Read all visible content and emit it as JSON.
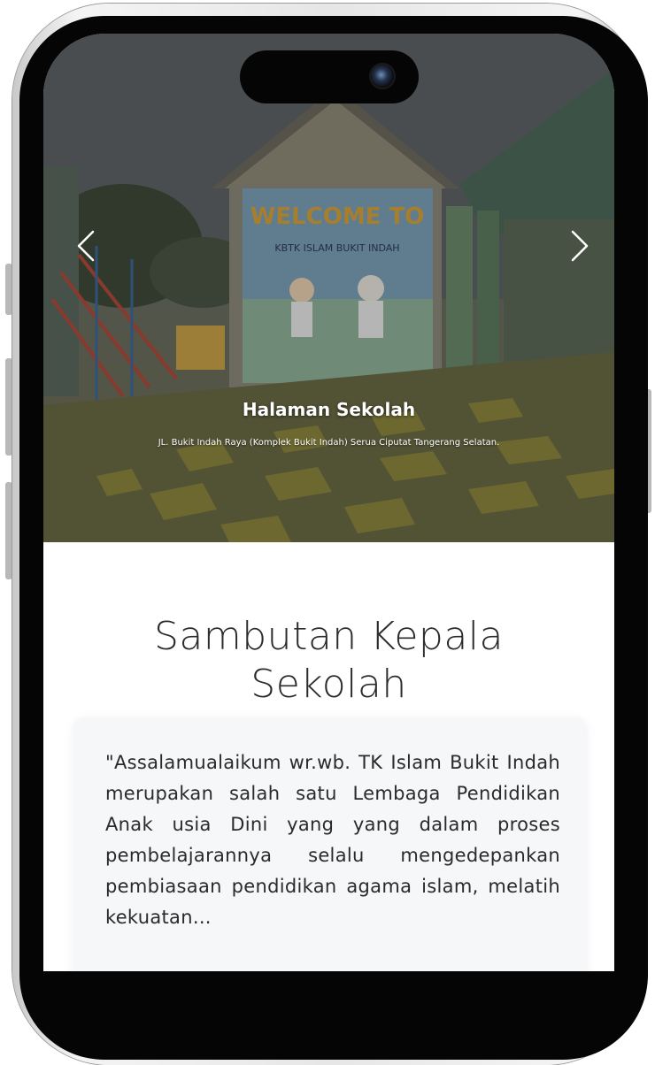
{
  "hero": {
    "slide_title": "Halaman Sekolah",
    "slide_subtitle": "JL. Bukit Indah Raya (Komplek Bukit Indah) Serua Ciputat Tangerang Selatan.",
    "mural_line1": "WELCOME TO",
    "mural_line2": "KBTK ISLAM BUKIT INDAH",
    "prev_icon": "chevron-left-icon",
    "next_icon": "chevron-right-icon"
  },
  "welcome": {
    "title": "Sambutan Kepala Sekolah",
    "message": "\"Assalamualaikum wr.wb. TK Islam Bukit Indah merupakan salah satu Lembaga Pendidikan Anak usia Dini yang yang dalam proses pembelajarannya selalu mengedepankan pembiasaan pendidikan agama islam, melatih kekuatan..."
  },
  "colors": {
    "title_text": "#2b2b2b",
    "card_bg": "#f5f7f9",
    "hero_text": "#ffffff"
  }
}
